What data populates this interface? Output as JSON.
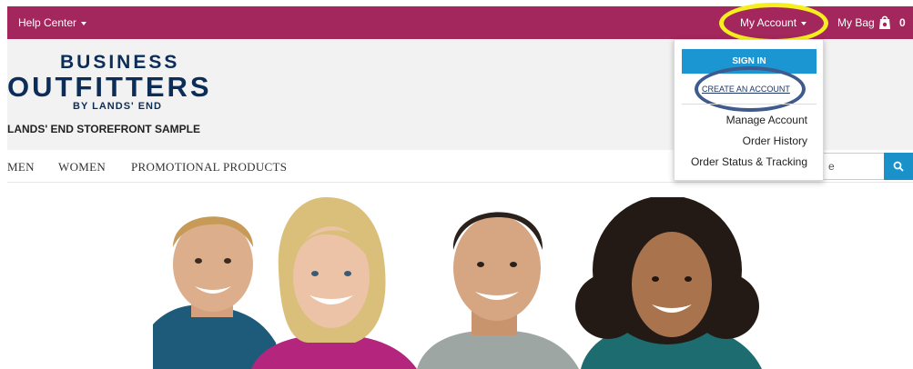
{
  "topbar": {
    "help_center": "Help Center",
    "my_account": "My Account",
    "my_bag": "My Bag",
    "bag_count": "0"
  },
  "header": {
    "logo_line1": "BUSINESS",
    "logo_line2": "OUTFITTERS",
    "logo_line3": "BY LANDS' END",
    "store_name": "LANDS' END STOREFRONT SAMPLE"
  },
  "nav": {
    "items": [
      "MEN",
      "WOMEN",
      "PROMOTIONAL PRODUCTS"
    ],
    "search_value": "e"
  },
  "account_menu": {
    "sign_in": "SIGN IN",
    "create_account": "CREATE AN ACCOUNT",
    "links": [
      "Manage Account",
      "Order History",
      "Order Status & Tracking"
    ]
  },
  "hero": {
    "people": [
      "man-blue-shirt",
      "woman-pink-shirt",
      "man-grey-shirt",
      "woman-teal-shirt"
    ]
  }
}
